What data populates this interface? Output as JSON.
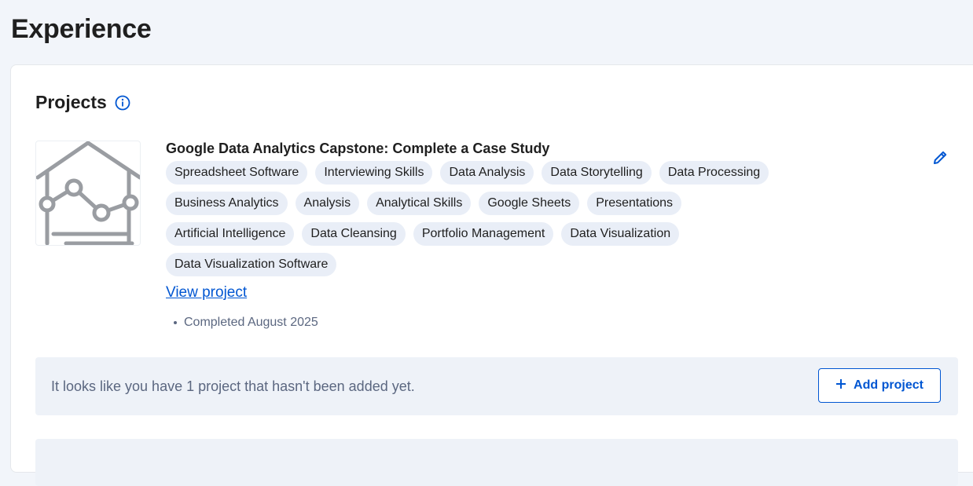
{
  "page": {
    "title": "Experience"
  },
  "projects": {
    "heading": "Projects",
    "info_icon": "info-circle-icon",
    "items": [
      {
        "title": "Google Data Analytics Capstone: Complete a Case Study",
        "thumbnail_icon": "house-chart-icon",
        "skills": [
          "Spreadsheet Software",
          "Interviewing Skills",
          "Data Analysis",
          "Data Storytelling",
          "Data Processing",
          "Business Analytics",
          "Analysis",
          "Analytical Skills",
          "Google Sheets",
          "Presentations",
          "Artificial Intelligence",
          "Data Cleansing",
          "Portfolio Management",
          "Data Visualization",
          "Data Visualization Software"
        ],
        "view_link": "View project",
        "completed": "Completed August 2025",
        "edit_icon": "pencil-icon"
      }
    ],
    "notice": {
      "text": "It looks like you have 1 project that hasn't been added yet.",
      "add_button": "Add project",
      "add_icon": "plus-icon"
    }
  },
  "colors": {
    "accent": "#0056d2",
    "chip_bg": "#e9eef7",
    "page_bg": "#f2f5fa",
    "muted_text": "#5b6780"
  }
}
